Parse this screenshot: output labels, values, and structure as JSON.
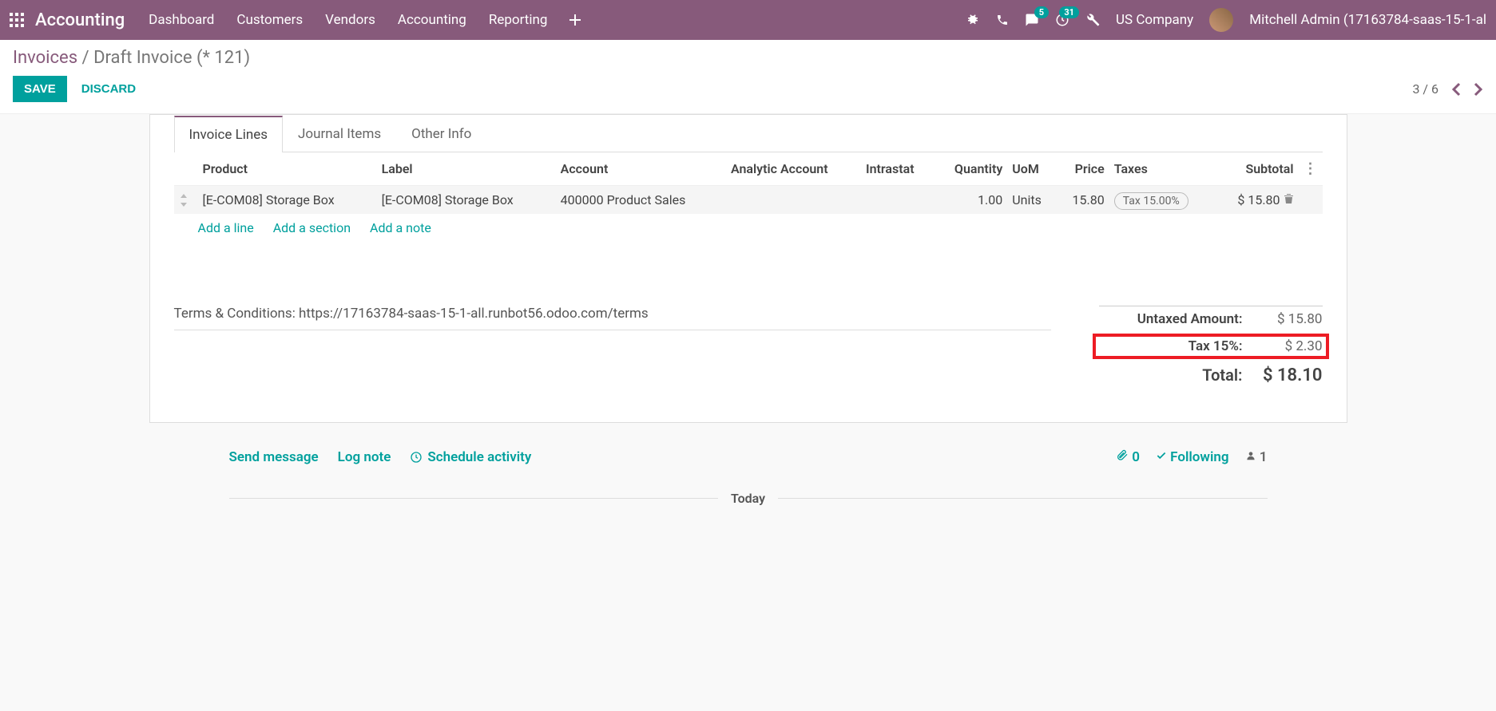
{
  "navbar": {
    "app_name": "Accounting",
    "menu": [
      "Dashboard",
      "Customers",
      "Vendors",
      "Accounting",
      "Reporting"
    ],
    "messages_badge": "5",
    "activities_badge": "31",
    "company": "US Company",
    "user": "Mitchell Admin (17163784-saas-15-1-al"
  },
  "breadcrumb": {
    "root": "Invoices",
    "sep": " / ",
    "current": "Draft Invoice (* 121)"
  },
  "actions": {
    "save": "SAVE",
    "discard": "DISCARD",
    "pager": "3 / 6"
  },
  "tabs": [
    "Invoice Lines",
    "Journal Items",
    "Other Info"
  ],
  "columns": {
    "product": "Product",
    "label": "Label",
    "account": "Account",
    "analytic": "Analytic Account",
    "intrastat": "Intrastat",
    "quantity": "Quantity",
    "uom": "UoM",
    "price": "Price",
    "taxes": "Taxes",
    "subtotal": "Subtotal"
  },
  "line": {
    "product": "[E-COM08] Storage Box",
    "label": "[E-COM08] Storage Box",
    "account": "400000 Product Sales",
    "analytic": "",
    "intrastat": "",
    "quantity": "1.00",
    "uom": "Units",
    "price": "15.80",
    "tax": "Tax 15.00%",
    "subtotal": "$ 15.80"
  },
  "add": {
    "line": "Add a line",
    "section": "Add a section",
    "note": "Add a note"
  },
  "terms": "Terms & Conditions: https://17163784-saas-15-1-all.runbot56.odoo.com/terms",
  "totals": {
    "untaxed_lbl": "Untaxed Amount:",
    "untaxed_val": "$ 15.80",
    "tax_lbl": "Tax 15%:",
    "tax_val": "$ 2.30",
    "total_lbl": "Total:",
    "total_val": "$ 18.10"
  },
  "chatter": {
    "send": "Send message",
    "log": "Log note",
    "schedule": "Schedule activity",
    "attachments": "0",
    "following": "Following",
    "followers": "1",
    "today": "Today"
  }
}
